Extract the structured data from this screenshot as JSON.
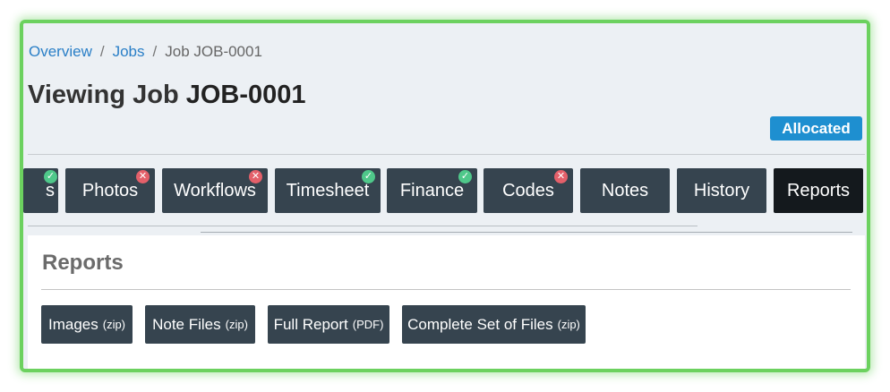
{
  "breadcrumb": {
    "items": [
      "Overview",
      "Jobs"
    ],
    "current": "Job JOB-0001",
    "separator": "/"
  },
  "header": {
    "title_prefix": "Viewing Job",
    "job_id": "JOB-0001",
    "status": "Allocated"
  },
  "tabs": [
    {
      "label": "s",
      "badge": "✓"
    },
    {
      "label": "Photos",
      "badge": "✕"
    },
    {
      "label": "Workflows",
      "badge": "✕"
    },
    {
      "label": "Timesheet",
      "badge": "✓"
    },
    {
      "label": "Finance",
      "badge": "✓"
    },
    {
      "label": "Codes",
      "badge": "✕"
    },
    {
      "label": "Notes",
      "badge": ""
    },
    {
      "label": "History",
      "badge": ""
    },
    {
      "label": "Reports",
      "badge": ""
    }
  ],
  "panel": {
    "title": "Reports",
    "buttons": [
      {
        "label": "Images",
        "suffix": "(zip)"
      },
      {
        "label": "Note Files",
        "suffix": "(zip)"
      },
      {
        "label": "Full Report",
        "suffix": "(PDF)"
      },
      {
        "label": "Complete Set of Files",
        "suffix": "(zip)"
      }
    ]
  },
  "colors": {
    "frame_border": "#6cd15f",
    "link": "#2a7fc7",
    "status_badge": "#1e8fd0",
    "tab_bg": "#36444f",
    "tab_active_bg": "#14191d",
    "badge_ok": "#4fc88a",
    "badge_err": "#e4606a"
  }
}
